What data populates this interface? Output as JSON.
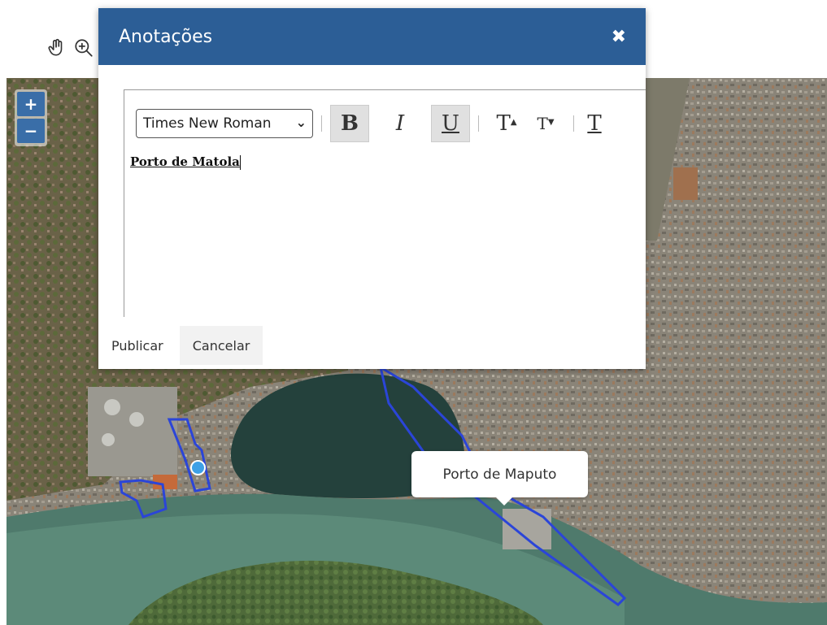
{
  "toolbar": {
    "pan_icon": "hand-icon",
    "zoom_icon": "zoom-in-icon"
  },
  "map": {
    "zoom_in_label": "+",
    "zoom_out_label": "−",
    "tooltip_text": "Porto de Maputo",
    "marker_color": "#3da0e6",
    "polygon_color": "#2b45d8"
  },
  "dialog": {
    "title": "Anotações",
    "close_icon": "close-icon",
    "header_color": "#2c5e96",
    "font_selected": "Times New Roman",
    "format_buttons": [
      {
        "label": "B",
        "icon": "bold-icon"
      },
      {
        "label": "I",
        "icon": "italic-icon"
      },
      {
        "label": "U",
        "icon": "underline-icon"
      },
      {
        "label": "T",
        "icon": "superscript-icon"
      },
      {
        "label": "T",
        "icon": "subscript-icon"
      },
      {
        "label": "T",
        "icon": "strikethrough-icon"
      }
    ],
    "content": "Porto de Matola",
    "publish_label": "Publicar",
    "cancel_label": "Cancelar"
  }
}
